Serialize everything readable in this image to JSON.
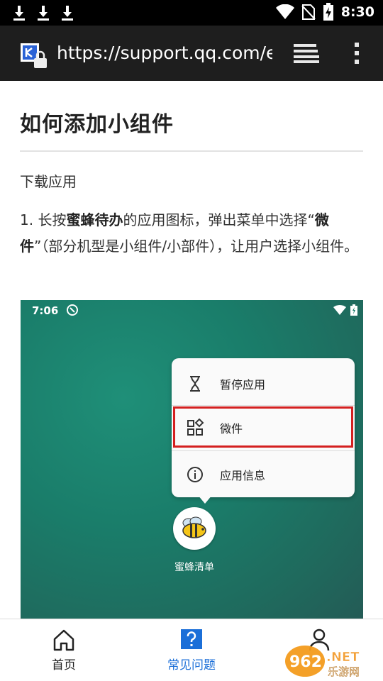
{
  "status_bar": {
    "time": "8:30",
    "left_icons": [
      "download-icon",
      "download-icon",
      "download-icon"
    ],
    "right_icons": [
      "wifi-icon",
      "no-sim-icon",
      "battery-charging-icon"
    ]
  },
  "browser": {
    "url": "https://support.qq.com/e",
    "favicon": "secure-site-favicon",
    "tabs_icon": "tabs-icon",
    "menu_icon": "more-vert-icon"
  },
  "article": {
    "title": "如何添加小组件",
    "subtitle": "下载应用",
    "step1": {
      "prefix": "1. 长按",
      "app_name": "蜜蜂待办",
      "mid": "的应用图标，弹出菜单中选择“",
      "widget_bold": "微件",
      "suffix": "”（部分机型是小组件/小部件），让用户选择小组件。"
    }
  },
  "screenshot": {
    "time": "7:06",
    "menu_items": [
      {
        "label": "暂停应用",
        "icon": "hourglass-icon"
      },
      {
        "label": "微件",
        "icon": "widgets-icon",
        "highlighted": true
      },
      {
        "label": "应用信息",
        "icon": "info-icon"
      }
    ],
    "app_label": "蜜蜂清单",
    "highlight_color": "#d42020"
  },
  "bottom_nav": {
    "items": [
      {
        "label": "首页",
        "icon": "home-icon",
        "active": false
      },
      {
        "label": "常见问题",
        "icon": "question-icon",
        "active": true
      },
      {
        "label": "",
        "icon": "user-icon",
        "active": false
      }
    ],
    "active_color": "#1b6fd8"
  },
  "watermark": {
    "text_top": "962.NET",
    "text_bottom": "乐游网"
  }
}
